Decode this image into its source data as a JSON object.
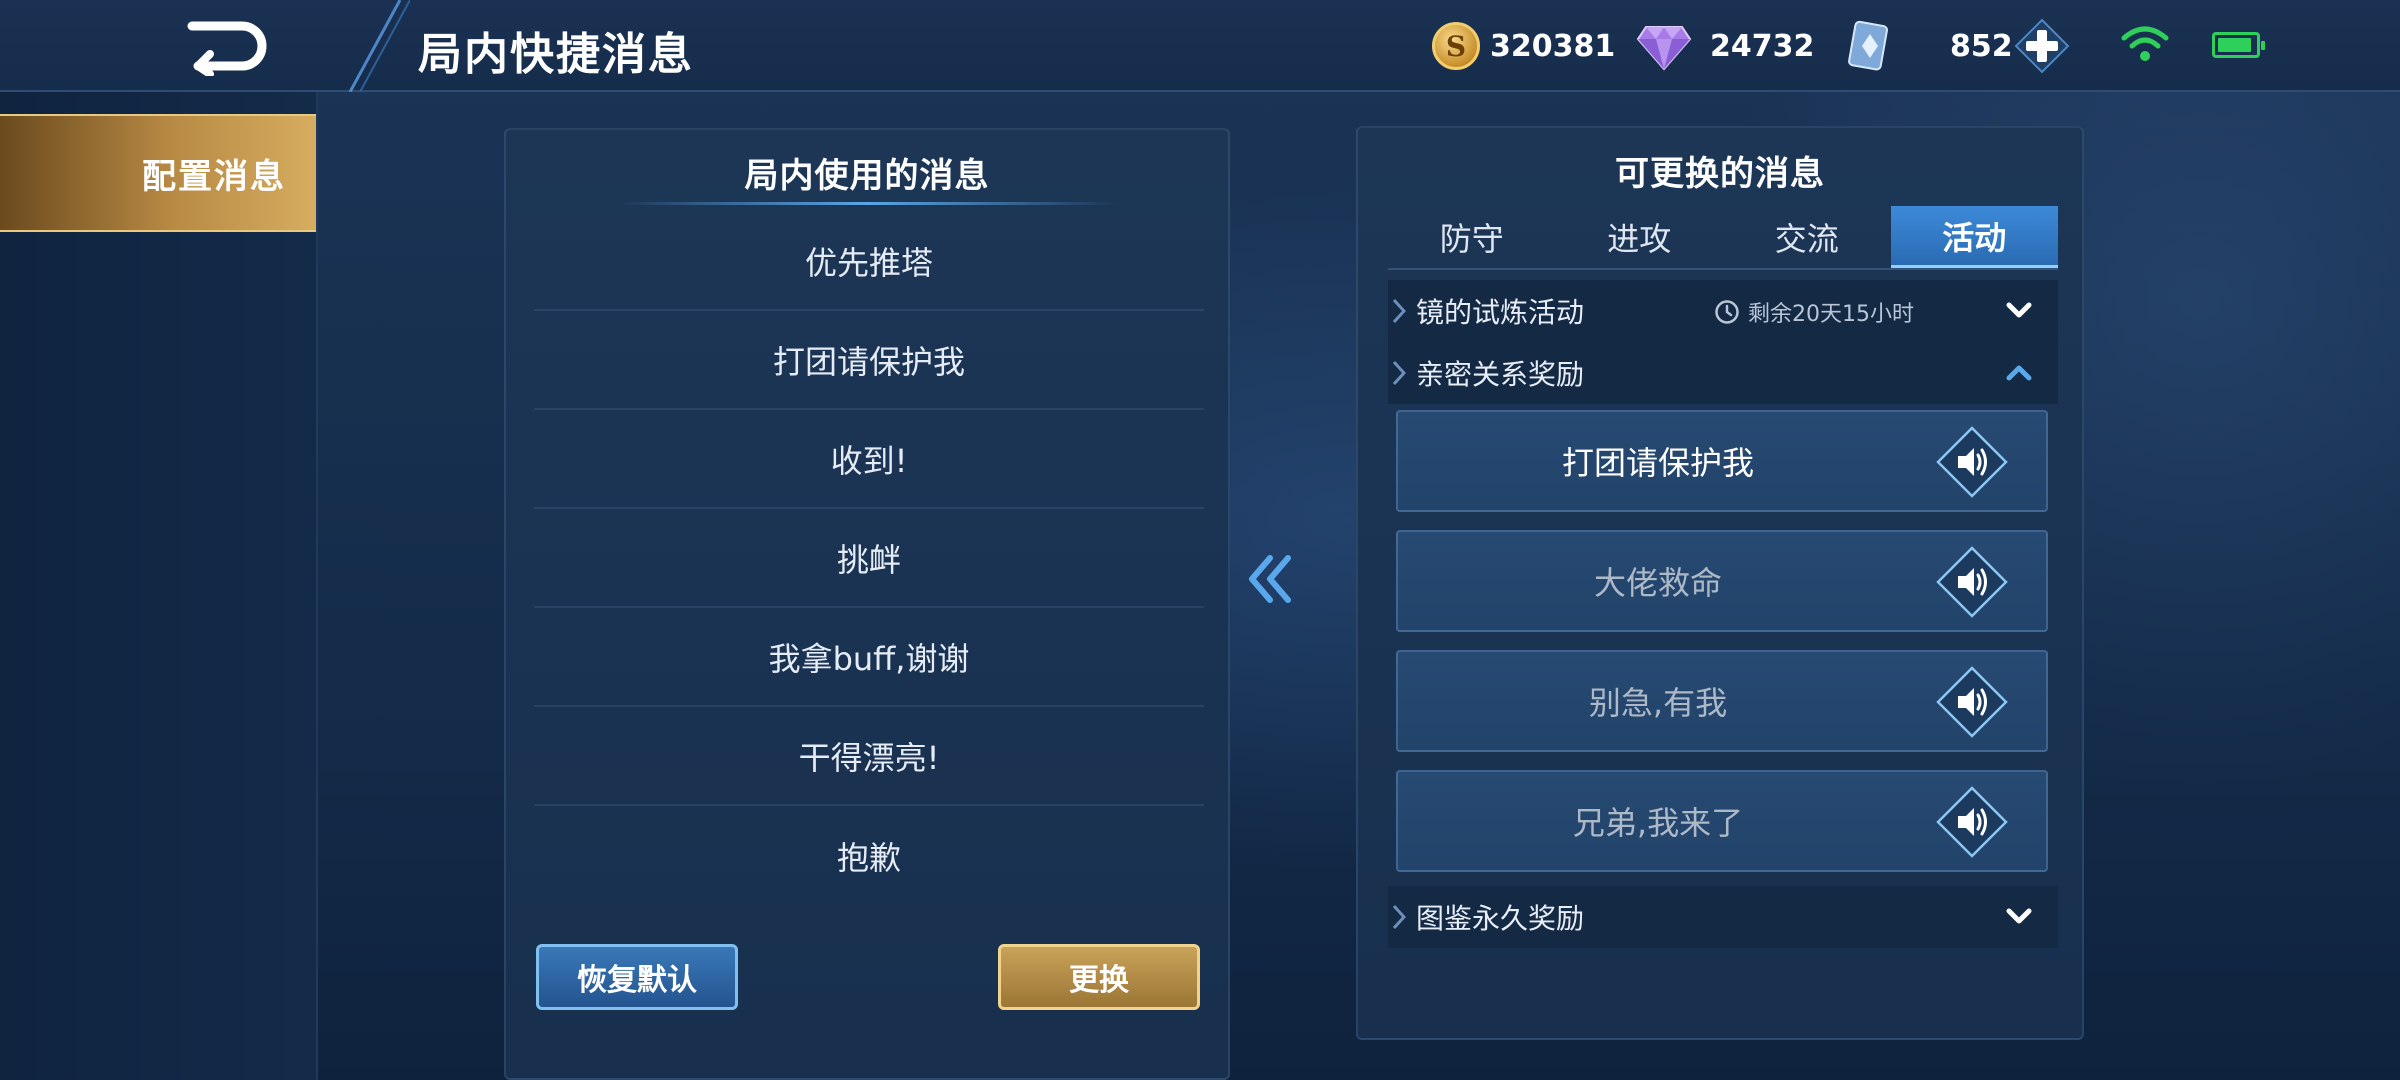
{
  "header": {
    "title": "局内快捷消息",
    "coins": "320381",
    "diamonds": "24732",
    "vouchers": "852"
  },
  "sidebar": {
    "items": [
      {
        "label": "配置消息",
        "active": true
      }
    ]
  },
  "left_panel": {
    "title": "局内使用的消息",
    "messages": [
      "优先推塔",
      "打团请保护我",
      "收到!",
      "挑衅",
      "我拿buff,谢谢",
      "干得漂亮!",
      "抱歉"
    ],
    "restore_label": "恢复默认",
    "swap_label": "更换"
  },
  "right_panel": {
    "title": "可更换的消息",
    "tabs": [
      "防守",
      "进攻",
      "交流",
      "活动"
    ],
    "active_tab": "活动",
    "categories": [
      {
        "label": "镜的试炼活动",
        "timer": "剩余20天15小时",
        "expanded": false
      },
      {
        "label": "亲密关系奖励",
        "expanded": true
      },
      {
        "label": "图鉴永久奖励",
        "expanded": false
      }
    ],
    "voice_messages": [
      {
        "label": "打团请保护我",
        "owned": true
      },
      {
        "label": "大佬救命",
        "owned": false
      },
      {
        "label": "别急,有我",
        "owned": false
      },
      {
        "label": "兄弟,我来了",
        "owned": false
      }
    ]
  },
  "colors": {
    "accent_blue": "#3d8ad8",
    "gold": "#c9a25a",
    "background": "#17304f"
  },
  "icons": [
    "back-icon",
    "coin-icon",
    "diamond-icon",
    "voucher-icon",
    "plus-icon",
    "wifi-icon",
    "battery-icon",
    "double-chevron-left-icon",
    "clock-icon",
    "chevron-down-icon",
    "chevron-up-icon",
    "sound-icon"
  ]
}
